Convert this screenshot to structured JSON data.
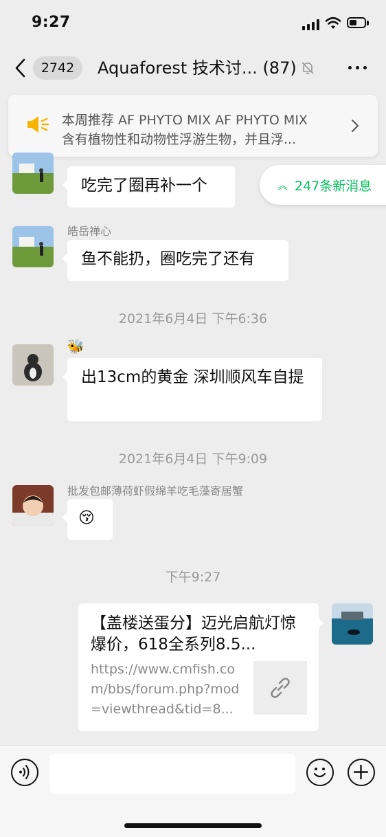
{
  "status_bar": {
    "time": "9:27"
  },
  "header": {
    "unread_count": "2742",
    "title": "Aquaforest 技术讨... (87)"
  },
  "pinned_notice": {
    "line1": "本周推荐  AF PHYTO MIX AF PHYTO MIX",
    "line2": "含有植物性和动物性浮游生物，并且浮..."
  },
  "new_messages": {
    "label": "247条新消息"
  },
  "messages": [
    {
      "sender": "皓岳禅心",
      "text": "吃完了圈再补一个"
    },
    {
      "sender": "皓岳禅心",
      "text": "鱼不能扔，圈吃完了还有"
    },
    {
      "timestamp": "2021年6月4日 下午6:36"
    },
    {
      "sender": "🐝",
      "text": "出13cm的黄金 深圳顺风车自提"
    },
    {
      "timestamp": "2021年6月4日 下午9:09"
    },
    {
      "sender": "批发包邮薄荷虾假绵羊吃毛藻寄居蟹",
      "text": "😚"
    },
    {
      "timestamp": "下午9:27"
    },
    {
      "link_card": {
        "title": "【盖楼送蛋分】迈光启航灯惊爆价，618全系列8.5...",
        "url": "https://www.cmfish.com/bbs/forum.php?mod=viewthread&tid=8..."
      }
    }
  ],
  "input_bar": {
    "placeholder": ""
  },
  "colors": {
    "accent": "#07c160",
    "background": "#ededed",
    "bubble": "#ffffff"
  }
}
